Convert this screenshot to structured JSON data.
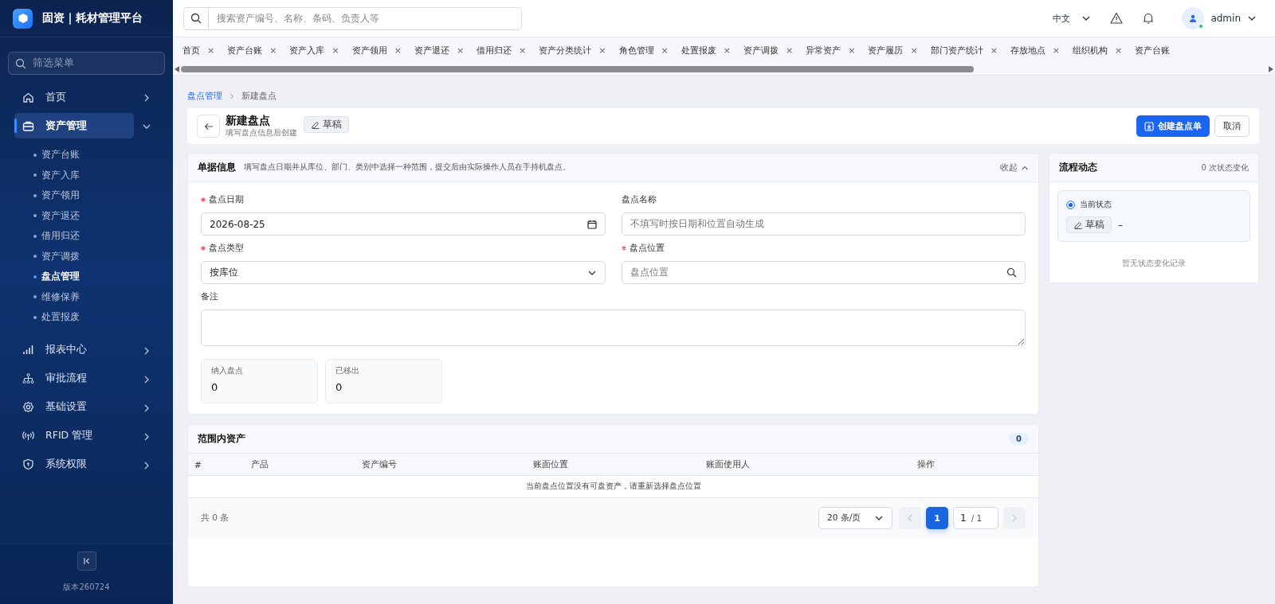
{
  "sidebar": {
    "logo_text": "固资｜耗材管理平台",
    "filter": {
      "placeholder": "筛选菜单"
    },
    "items": [
      {
        "label": "首页",
        "expanded": false,
        "selected": false
      },
      {
        "label": "资产管理",
        "expanded": true,
        "selected": true,
        "children": [
          {
            "label": "资产台账",
            "selected": false
          },
          {
            "label": "资产入库",
            "selected": false
          },
          {
            "label": "资产领用",
            "selected": false
          },
          {
            "label": "资产退还",
            "selected": false
          },
          {
            "label": "借用归还",
            "selected": false
          },
          {
            "label": "资产调拨",
            "selected": false
          },
          {
            "label": "盘点管理",
            "selected": true
          },
          {
            "label": "维修保养",
            "selected": false
          },
          {
            "label": "处置报废",
            "selected": false
          }
        ]
      },
      {
        "label": "报表中心",
        "expanded": false,
        "selected": false
      },
      {
        "label": "审批流程",
        "expanded": false,
        "selected": false
      },
      {
        "label": "基础设置",
        "expanded": false,
        "selected": false
      },
      {
        "label": "RFID 管理",
        "expanded": false,
        "selected": false
      },
      {
        "label": "系统权限",
        "expanded": false,
        "selected": false
      }
    ],
    "version": "版本260724"
  },
  "topbar": {
    "search": {
      "placeholder": "搜索资产编号、名称、条码、负责人等"
    },
    "language": "中文",
    "user": "admin"
  },
  "tabs": [
    {
      "label": "首页",
      "selected": false,
      "close": "×"
    },
    {
      "label": "资产台账",
      "selected": false,
      "close": "×"
    },
    {
      "label": "资产入库",
      "selected": false,
      "close": "×"
    },
    {
      "label": "资产领用",
      "selected": false,
      "close": "×"
    },
    {
      "label": "资产退还",
      "selected": false,
      "close": "×"
    },
    {
      "label": "借用归还",
      "selected": false,
      "close": "×"
    },
    {
      "label": "资产分类统计",
      "selected": false,
      "close": "×"
    },
    {
      "label": "角色管理",
      "selected": false,
      "close": "×"
    },
    {
      "label": "处置报废",
      "selected": false,
      "close": "×"
    },
    {
      "label": "资产调拨",
      "selected": false,
      "close": "×"
    },
    {
      "label": "异常资产",
      "selected": false,
      "close": "×"
    },
    {
      "label": "资产履历",
      "selected": false,
      "close": "×"
    },
    {
      "label": "部门资产统计",
      "selected": false,
      "close": "×"
    },
    {
      "label": "存放地点",
      "selected": false,
      "close": "×"
    },
    {
      "label": "组织机构",
      "selected": false,
      "close": "×"
    },
    {
      "label": "资产台账",
      "selected": false
    }
  ],
  "breadcrumb": [
    "盘点管理",
    "新建盘点"
  ],
  "header": {
    "title": "新建盘点",
    "subtitle": "填写盘点信息后创建",
    "status": "草稿",
    "primary_button": "创建盘点单",
    "cancel_button": "取消"
  },
  "form_card": {
    "title": "单据信息",
    "hint": "填写盘点日期并从库位、部门、类别中选择一种范围，提交后由实际操作人员在手持机盘点。",
    "collapse": "收起",
    "fields": [
      {
        "kind": "date",
        "label": "盘点日期",
        "required": true,
        "value": "2026-08-25"
      },
      {
        "kind": "text",
        "label": "盘点名称",
        "required": false,
        "placeholder": "不填写时按日期和位置自动生成"
      },
      {
        "kind": "select",
        "label": "盘点类型",
        "required": true,
        "value": "按库位"
      },
      {
        "kind": "search",
        "label": "盘点位置",
        "required": true,
        "placeholder": "盘点位置"
      },
      {
        "kind": "textarea",
        "label": "备注",
        "required": false
      }
    ],
    "stats": [
      {
        "label": "纳入盘点",
        "value": "0"
      },
      {
        "label": "已移出",
        "value": "0"
      }
    ]
  },
  "flow_card": {
    "title": "流程动态",
    "count": "0 次状态变化",
    "current_label": "当前状态",
    "current_status": "草稿",
    "current_time": "–",
    "empty": "暂无状态变化记录"
  },
  "assets_card": {
    "title": "范围内资产",
    "count": "0",
    "columns": [
      "#",
      "产品",
      "资产编号",
      "账面位置",
      "账面使用人",
      "操作"
    ],
    "empty": "当前盘点位置没有可盘资产，请重新选择盘点位置",
    "total": "共 0 条",
    "page_size": "20 条/页",
    "current_page": "1",
    "page_input": "1",
    "page_total": "/ 1"
  }
}
